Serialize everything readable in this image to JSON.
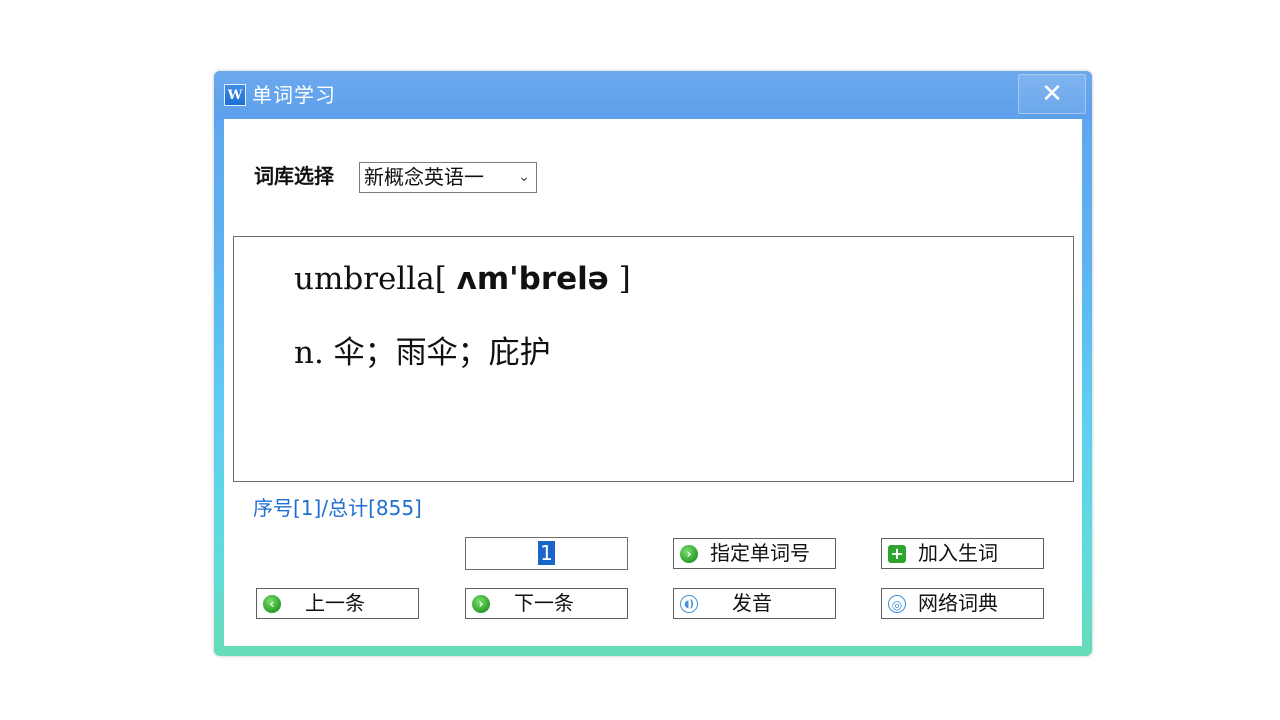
{
  "window": {
    "title": "单词学习",
    "icon": "word-app-icon",
    "icon_letter": "W",
    "close_glyph": "✕"
  },
  "library": {
    "label": "词库选择",
    "selected": "新概念英语一",
    "chevron": "⌄"
  },
  "entry": {
    "word": "umbrella",
    "phonetic_open": "[ ",
    "phonetic": "ʌm'brelə",
    "phonetic_close": " ]",
    "meaning": "n. 伞；雨伞；庇护"
  },
  "status": {
    "counter_text": "序号[1]/总计[855]"
  },
  "controls": {
    "number_input_value": "1",
    "goto_label": "指定单词号",
    "add_new_word_label": "加入生词",
    "prev_label": "上一条",
    "next_label": "下一条",
    "pronounce_label": "发音",
    "web_dict_label": "网络词典"
  },
  "colors": {
    "accent_blue": "#1f6fd0",
    "titlebar": "#5e9fec"
  }
}
